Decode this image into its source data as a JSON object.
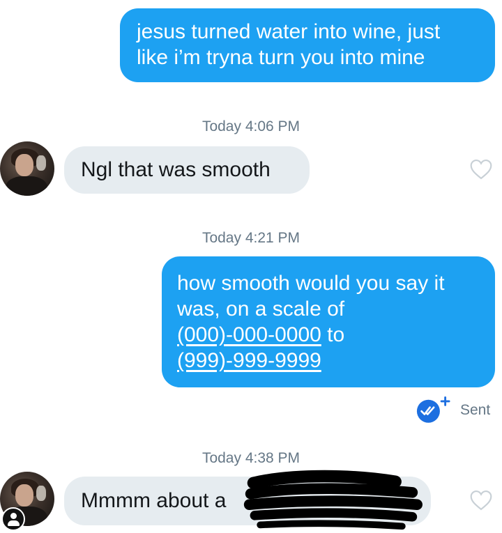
{
  "conversation": {
    "messages": [
      {
        "direction": "outgoing",
        "lines": [
          "jesus turned water into wine, just",
          "like i’m tryna turn you into mine"
        ]
      },
      {
        "timestamp": "Today 4:06 PM"
      },
      {
        "direction": "incoming",
        "text": "Ngl that was smooth"
      },
      {
        "timestamp": "Today 4:21 PM"
      },
      {
        "direction": "outgoing",
        "line1": "how smooth would you say it",
        "line2": "was, on a scale of",
        "phone_low": "(000)-000-0000",
        "word_to": " to",
        "phone_high": "(999)-999-9999"
      },
      {
        "status": "Sent"
      },
      {
        "timestamp": "Today 4:38 PM"
      },
      {
        "direction": "incoming",
        "text": "Mmmm about a",
        "redacted": true
      }
    ]
  },
  "colors": {
    "outgoing_bubble": "#1da1f2",
    "incoming_bubble": "#e6ecf0",
    "timestamp_text": "#657786",
    "read_badge": "#1d6fe0"
  },
  "icons": [
    "heart-outline-icon",
    "read-receipt-icon",
    "avatar"
  ]
}
